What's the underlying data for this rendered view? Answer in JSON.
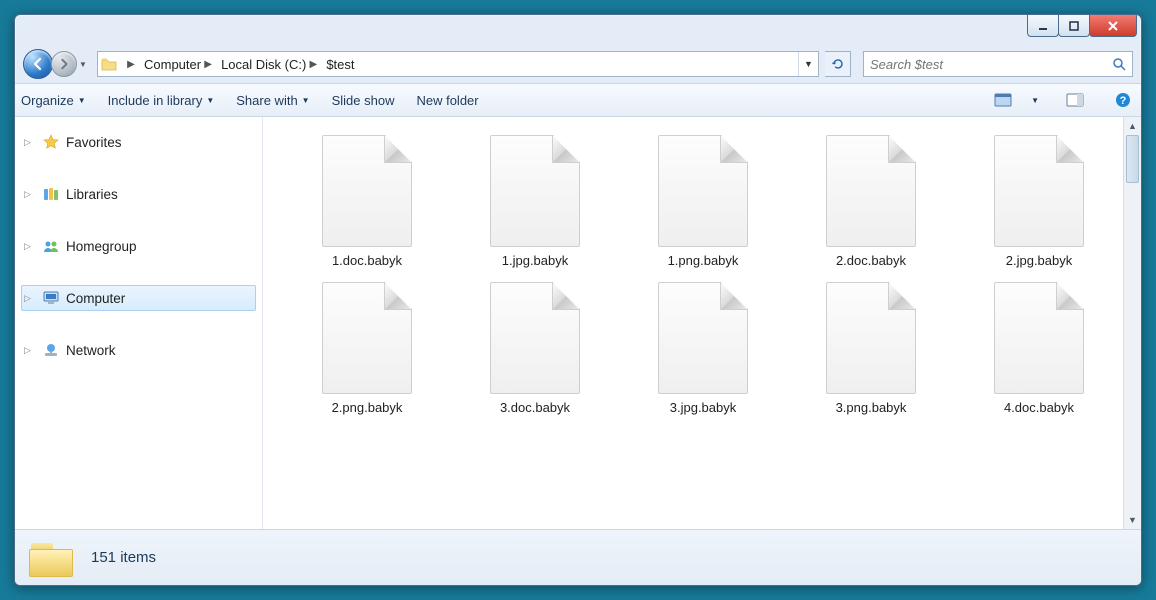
{
  "breadcrumb": {
    "items": [
      "Computer",
      "Local Disk (C:)",
      "$test"
    ]
  },
  "search": {
    "placeholder": "Search $test"
  },
  "toolbar": {
    "organize": "Organize",
    "include": "Include in library",
    "share": "Share with",
    "slideshow": "Slide show",
    "newfolder": "New folder"
  },
  "sidebar": {
    "items": [
      {
        "label": "Favorites"
      },
      {
        "label": "Libraries"
      },
      {
        "label": "Homegroup"
      },
      {
        "label": "Computer"
      },
      {
        "label": "Network"
      }
    ],
    "selected_index": 3
  },
  "files": [
    "1.doc.babyk",
    "1.jpg.babyk",
    "1.png.babyk",
    "2.doc.babyk",
    "2.jpg.babyk",
    "2.png.babyk",
    "3.doc.babyk",
    "3.jpg.babyk",
    "3.png.babyk",
    "4.doc.babyk"
  ],
  "status": {
    "count_text": "151 items"
  }
}
